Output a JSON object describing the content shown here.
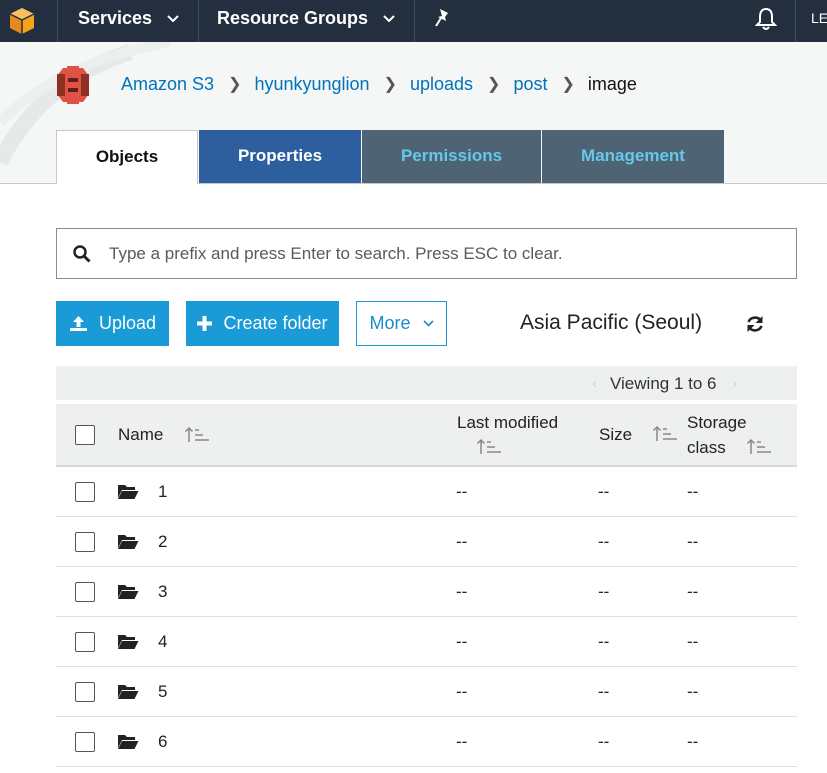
{
  "nav": {
    "services_label": "Services",
    "resource_groups_label": "Resource Groups",
    "user_label": "LE"
  },
  "breadcrumb": {
    "items": [
      "Amazon S3",
      "hyunkyunglion",
      "uploads",
      "post"
    ],
    "current": "image"
  },
  "tabs": {
    "objects": "Objects",
    "properties": "Properties",
    "permissions": "Permissions",
    "management": "Management"
  },
  "search": {
    "placeholder": "Type a prefix and press Enter to search. Press ESC to clear.",
    "value": ""
  },
  "toolbar": {
    "upload_label": "Upload",
    "create_folder_label": "Create folder",
    "more_label": "More",
    "region": "Asia Pacific (Seoul)"
  },
  "table": {
    "paging": "Viewing 1 to 6",
    "columns": {
      "name": "Name",
      "last_modified": "Last modified",
      "size": "Size",
      "storage_class_1": "Storage",
      "storage_class_2": "class"
    },
    "rows": [
      {
        "name": "1",
        "last_modified": "--",
        "size": "--",
        "storage_class": "--"
      },
      {
        "name": "2",
        "last_modified": "--",
        "size": "--",
        "storage_class": "--"
      },
      {
        "name": "3",
        "last_modified": "--",
        "size": "--",
        "storage_class": "--"
      },
      {
        "name": "4",
        "last_modified": "--",
        "size": "--",
        "storage_class": "--"
      },
      {
        "name": "5",
        "last_modified": "--",
        "size": "--",
        "storage_class": "--"
      },
      {
        "name": "6",
        "last_modified": "--",
        "size": "--",
        "storage_class": "--"
      }
    ]
  },
  "colors": {
    "nav_bg": "#232f3e",
    "link": "#0073bb",
    "primary_button": "#1a9ad6",
    "tab_active_dark": "#2d5f9e",
    "tab_inactive": "#4e6475",
    "tab_inactive_text": "#65c8e8"
  }
}
